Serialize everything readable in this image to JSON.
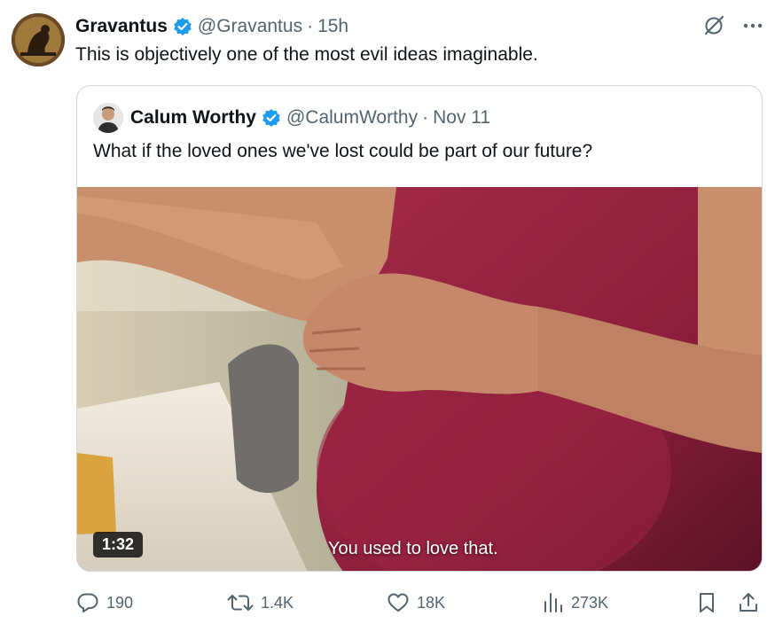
{
  "tweet": {
    "author_name": "Gravantus",
    "handle": "@Gravantus",
    "separator": "·",
    "time": "15h",
    "text": "This is objectively one of the most evil ideas imaginable."
  },
  "quoted": {
    "author_name": "Calum Worthy",
    "handle": "@CalumWorthy",
    "separator": "·",
    "date": "Nov 11",
    "text": "What if the loved ones we've lost could be part of our future?",
    "video": {
      "duration": "1:32",
      "subtitle": "You used to love that."
    }
  },
  "actions": {
    "replies": "190",
    "reposts": "1.4K",
    "likes": "18K",
    "views": "273K"
  },
  "colors": {
    "text_primary": "#0f1419",
    "text_secondary": "#536471",
    "verified_blue": "#1d9bf0",
    "border": "#cfd9de"
  },
  "icons": [
    "verified-badge-icon",
    "grok-icon",
    "more-icon",
    "reply-icon",
    "repost-icon",
    "like-icon",
    "views-icon",
    "bookmark-icon",
    "share-icon"
  ]
}
